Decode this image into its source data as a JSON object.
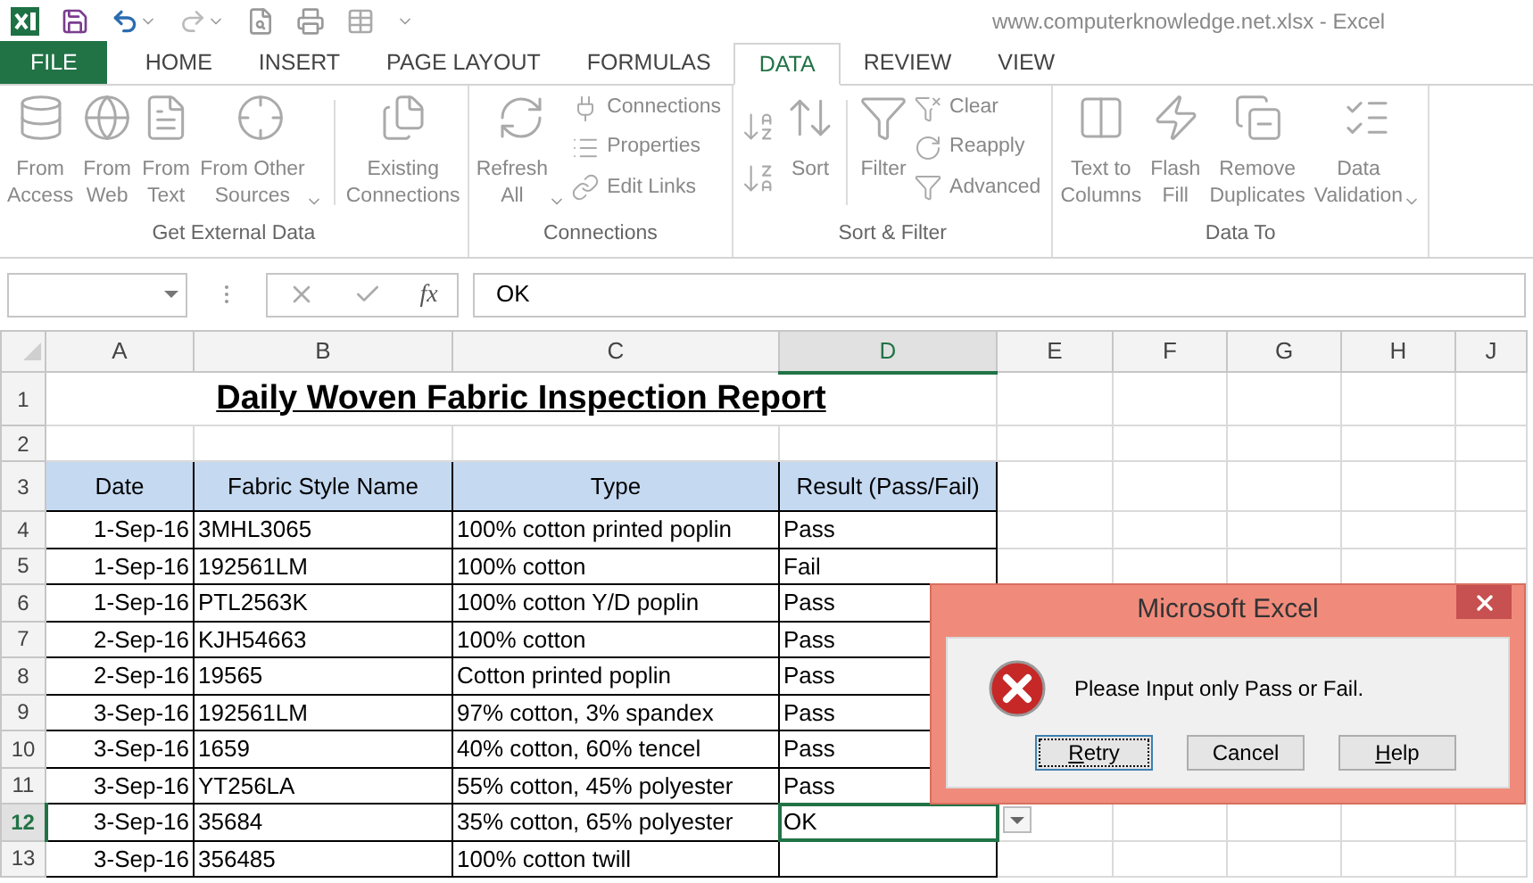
{
  "window": {
    "title": "www.computerknowledge.net.xlsx - Excel"
  },
  "tabs": [
    {
      "label": "FILE",
      "kind": "file"
    },
    {
      "label": "HOME",
      "kind": "tab",
      "selected": false
    },
    {
      "label": "INSERT",
      "kind": "tab",
      "selected": false
    },
    {
      "label": "PAGE LAYOUT",
      "kind": "tab",
      "selected": false
    },
    {
      "label": "FORMULAS",
      "kind": "tab",
      "selected": false
    },
    {
      "label": "DATA",
      "kind": "tab",
      "selected": true
    },
    {
      "label": "REVIEW",
      "kind": "tab",
      "selected": false
    },
    {
      "label": "VIEW",
      "kind": "tab",
      "selected": false
    }
  ],
  "ribbon": {
    "groups": [
      {
        "label": "Get External Data",
        "commands": [
          {
            "kind": "large",
            "label": "From\nAccess",
            "dropdown": false
          },
          {
            "kind": "large",
            "label": "From\nWeb",
            "dropdown": false
          },
          {
            "kind": "large",
            "label": "From\nText",
            "dropdown": false
          },
          {
            "kind": "large",
            "label": "From Other\nSources",
            "dropdown": true
          },
          {
            "kind": "separator"
          },
          {
            "kind": "large",
            "label": "Existing\nConnections",
            "dropdown": false
          }
        ]
      },
      {
        "label": "Connections",
        "commands": [
          {
            "kind": "large",
            "label": "Refresh\nAll",
            "dropdown": true
          },
          {
            "kind": "stack",
            "items": [
              "Connections",
              "Properties",
              "Edit Links"
            ]
          }
        ]
      },
      {
        "label": "Sort & Filter",
        "commands": [
          {
            "kind": "sort_pair"
          },
          {
            "kind": "large",
            "label": "Sort",
            "dropdown": false
          },
          {
            "kind": "separator"
          },
          {
            "kind": "large",
            "label": "Filter",
            "dropdown": false
          },
          {
            "kind": "stack",
            "items": [
              "Clear",
              "Reapply",
              "Advanced"
            ]
          }
        ]
      },
      {
        "label": "Data To",
        "commands": [
          {
            "kind": "large",
            "label": "Text to\nColumns",
            "dropdown": false
          },
          {
            "kind": "large",
            "label": "Flash\nFill",
            "dropdown": false
          },
          {
            "kind": "large",
            "label": "Remove\nDuplicates",
            "dropdown": false
          },
          {
            "kind": "large",
            "label": "Data\nValidation",
            "dropdown": true
          }
        ]
      }
    ]
  },
  "formula_bar": {
    "insert_function": "fx",
    "value": "OK"
  },
  "sheet": {
    "columns": [
      {
        "label": "A",
        "selected": false
      },
      {
        "label": "B",
        "selected": false
      },
      {
        "label": "C",
        "selected": false
      },
      {
        "label": "D",
        "selected": true
      },
      {
        "label": "E",
        "selected": false
      },
      {
        "label": "F",
        "selected": false
      },
      {
        "label": "G",
        "selected": false
      },
      {
        "label": "H",
        "selected": false
      },
      {
        "label": "J",
        "selected": false
      }
    ],
    "rows": [
      {
        "number": "1",
        "selected": false,
        "kind": "title",
        "title": "Daily Woven Fabric Inspection Report"
      },
      {
        "number": "2",
        "selected": false,
        "kind": "blank"
      },
      {
        "number": "3",
        "selected": false,
        "kind": "header",
        "cells": [
          "Date",
          "Fabric Style Name",
          "Type",
          "Result (Pass/Fail)"
        ]
      },
      {
        "number": "4",
        "selected": false,
        "kind": "data",
        "cells": [
          "1-Sep-16",
          "3MHL3065",
          "100% cotton printed poplin",
          "Pass"
        ]
      },
      {
        "number": "5",
        "selected": false,
        "kind": "data",
        "cells": [
          "1-Sep-16",
          "192561LM",
          "100% cotton",
          "Fail"
        ]
      },
      {
        "number": "6",
        "selected": false,
        "kind": "data",
        "cells": [
          "1-Sep-16",
          "PTL2563K",
          "100% cotton Y/D poplin",
          "Pass"
        ]
      },
      {
        "number": "7",
        "selected": false,
        "kind": "data",
        "cells": [
          "2-Sep-16",
          "KJH54663",
          "100% cotton",
          "Pass"
        ]
      },
      {
        "number": "8",
        "selected": false,
        "kind": "data",
        "cells": [
          "2-Sep-16",
          "19565",
          "Cotton printed poplin",
          "Pass"
        ]
      },
      {
        "number": "9",
        "selected": false,
        "kind": "data",
        "cells": [
          "3-Sep-16",
          "192561LM",
          "97% cotton, 3% spandex",
          "Pass"
        ]
      },
      {
        "number": "10",
        "selected": false,
        "kind": "data",
        "cells": [
          "3-Sep-16",
          "1659",
          "40% cotton, 60% tencel",
          "Pass"
        ]
      },
      {
        "number": "11",
        "selected": false,
        "kind": "data",
        "cells": [
          "3-Sep-16",
          "YT256LA",
          "55% cotton, 45% polyester",
          "Pass"
        ]
      },
      {
        "number": "12",
        "selected": true,
        "kind": "data",
        "cells": [
          "3-Sep-16",
          "35684",
          "35% cotton, 65% polyester",
          "OK"
        ]
      },
      {
        "number": "13",
        "selected": false,
        "kind": "data",
        "cells": [
          "3-Sep-16",
          "356485",
          "100% cotton twill"
        ]
      }
    ]
  },
  "dialog": {
    "title": "Microsoft Excel",
    "message": "Please Input only Pass or Fail.",
    "buttons": [
      {
        "label": "Retry",
        "focused": true,
        "mnemonic": true
      },
      {
        "label": "Cancel",
        "focused": false,
        "mnemonic": false
      },
      {
        "label": "Help",
        "focused": false,
        "mnemonic": true
      }
    ]
  }
}
